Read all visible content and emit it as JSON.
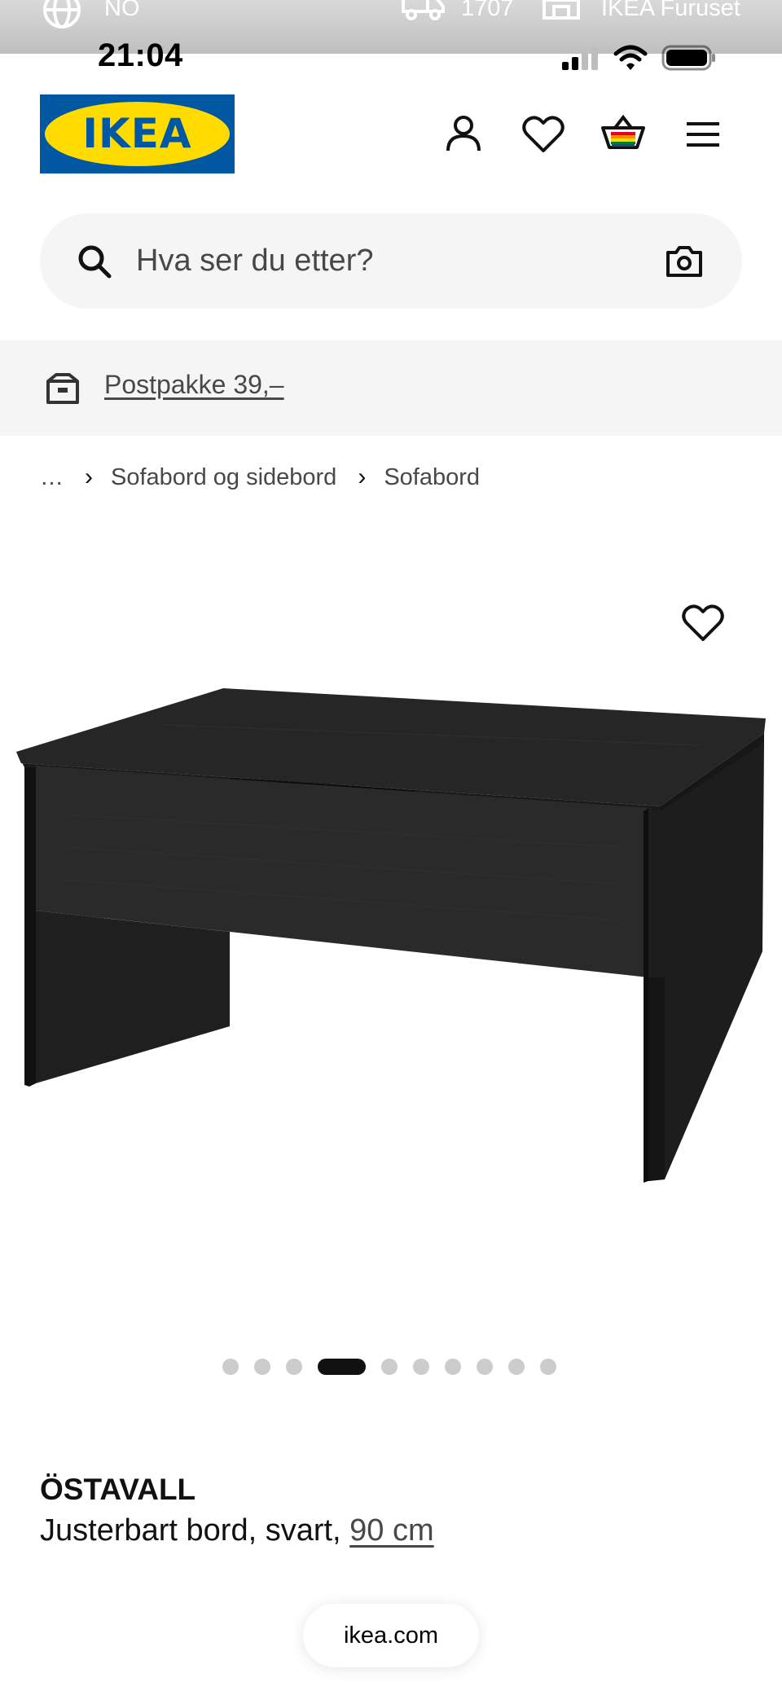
{
  "overlay": {
    "language": "NO",
    "postcode": "1707",
    "store": "IKEA Furuset"
  },
  "status_bar": {
    "time": "21:04"
  },
  "header": {
    "logo_text": "IKEA",
    "icons": [
      "account-icon",
      "wishlist-icon",
      "cart-icon",
      "menu-icon"
    ]
  },
  "search": {
    "placeholder": "Hva ser du etter?"
  },
  "promo": {
    "label": "Postpakke 39,–"
  },
  "breadcrumb": {
    "ellipsis": "…",
    "items": [
      "Sofabord og sidebord",
      "Sofabord"
    ]
  },
  "gallery": {
    "image_count": 10,
    "active_index": 3
  },
  "product": {
    "name": "ÖSTAVALL",
    "description": "Justerbart bord, svart,",
    "size": "90 cm"
  },
  "browser": {
    "url": "ikea.com"
  },
  "colors": {
    "brand_blue": "#0058a3",
    "brand_yellow": "#ffdb00",
    "search_bg": "#f5f5f5",
    "text": "#111111"
  }
}
